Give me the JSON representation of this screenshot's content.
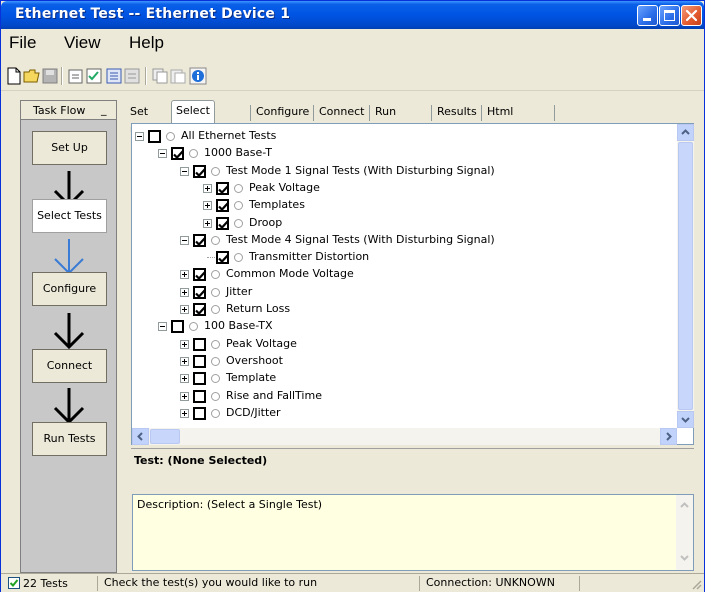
{
  "window": {
    "title": "Ethernet Test -- Ethernet Device 1"
  },
  "menu": {
    "items": [
      "File",
      "View",
      "Help"
    ]
  },
  "toolbar": {
    "icons": [
      "new-file-icon",
      "open-folder-icon",
      "save-icon",
      "properties-icon",
      "checklist-icon",
      "run-icon",
      "stop-icon",
      "copy-icon",
      "paste-icon",
      "info-icon"
    ]
  },
  "taskflow": {
    "title": "Task Flow",
    "close_glyph": "_",
    "steps": [
      "Set Up",
      "Select Tests",
      "Configure",
      "Connect",
      "Run Tests"
    ],
    "active_step": "Select Tests"
  },
  "tabs": {
    "items": [
      "Set Up",
      "Select Tests",
      "Configure",
      "Connect",
      "Run Tests",
      "Results",
      "Html Report"
    ],
    "active": "Select Tests"
  },
  "tree": {
    "rows": [
      {
        "label": "All Ethernet Tests",
        "level": 0,
        "expander": "minus",
        "checked": false
      },
      {
        "label": "1000 Base-T",
        "level": 1,
        "expander": "minus",
        "checked": true
      },
      {
        "label": "Test Mode 1 Signal Tests (With Disturbing Signal)",
        "level": 2,
        "expander": "minus",
        "checked": true
      },
      {
        "label": "Peak Voltage",
        "level": 3,
        "expander": "plus",
        "checked": true
      },
      {
        "label": "Templates",
        "level": 3,
        "expander": "plus",
        "checked": true
      },
      {
        "label": "Droop",
        "level": 3,
        "expander": "plus",
        "checked": true
      },
      {
        "label": "Test Mode 4 Signal Tests (With Disturbing Signal)",
        "level": 2,
        "expander": "minus",
        "checked": true
      },
      {
        "label": "Transmitter Distortion",
        "level": 3,
        "expander": "none",
        "checked": true
      },
      {
        "label": "Common Mode Voltage",
        "level": 2,
        "expander": "plus",
        "checked": true
      },
      {
        "label": "Jitter",
        "level": 2,
        "expander": "plus",
        "checked": true
      },
      {
        "label": "Return Loss",
        "level": 2,
        "expander": "plus",
        "checked": true
      },
      {
        "label": "100 Base-TX",
        "level": 1,
        "expander": "minus",
        "checked": false
      },
      {
        "label": "Peak Voltage",
        "level": 2,
        "expander": "plus",
        "checked": false
      },
      {
        "label": "Overshoot",
        "level": 2,
        "expander": "plus",
        "checked": false
      },
      {
        "label": "Template",
        "level": 2,
        "expander": "plus",
        "checked": false
      },
      {
        "label": "Rise and FallTime",
        "level": 2,
        "expander": "plus",
        "checked": false
      },
      {
        "label": "DCD/Jitter",
        "level": 2,
        "expander": "plus",
        "checked": false
      }
    ]
  },
  "test_info": {
    "title": "Test: (None Selected)",
    "description": "Description: (Select a Single Test)"
  },
  "status": {
    "test_count": "22 Tests",
    "hint": "Check the test(s) you would like to run",
    "connection": "Connection: UNKNOWN"
  },
  "colors": {
    "titlebar": "#0054e3",
    "active_arrow": "#3a7bd5",
    "arrow": "#000000",
    "description_bg": "#ffffe1"
  }
}
